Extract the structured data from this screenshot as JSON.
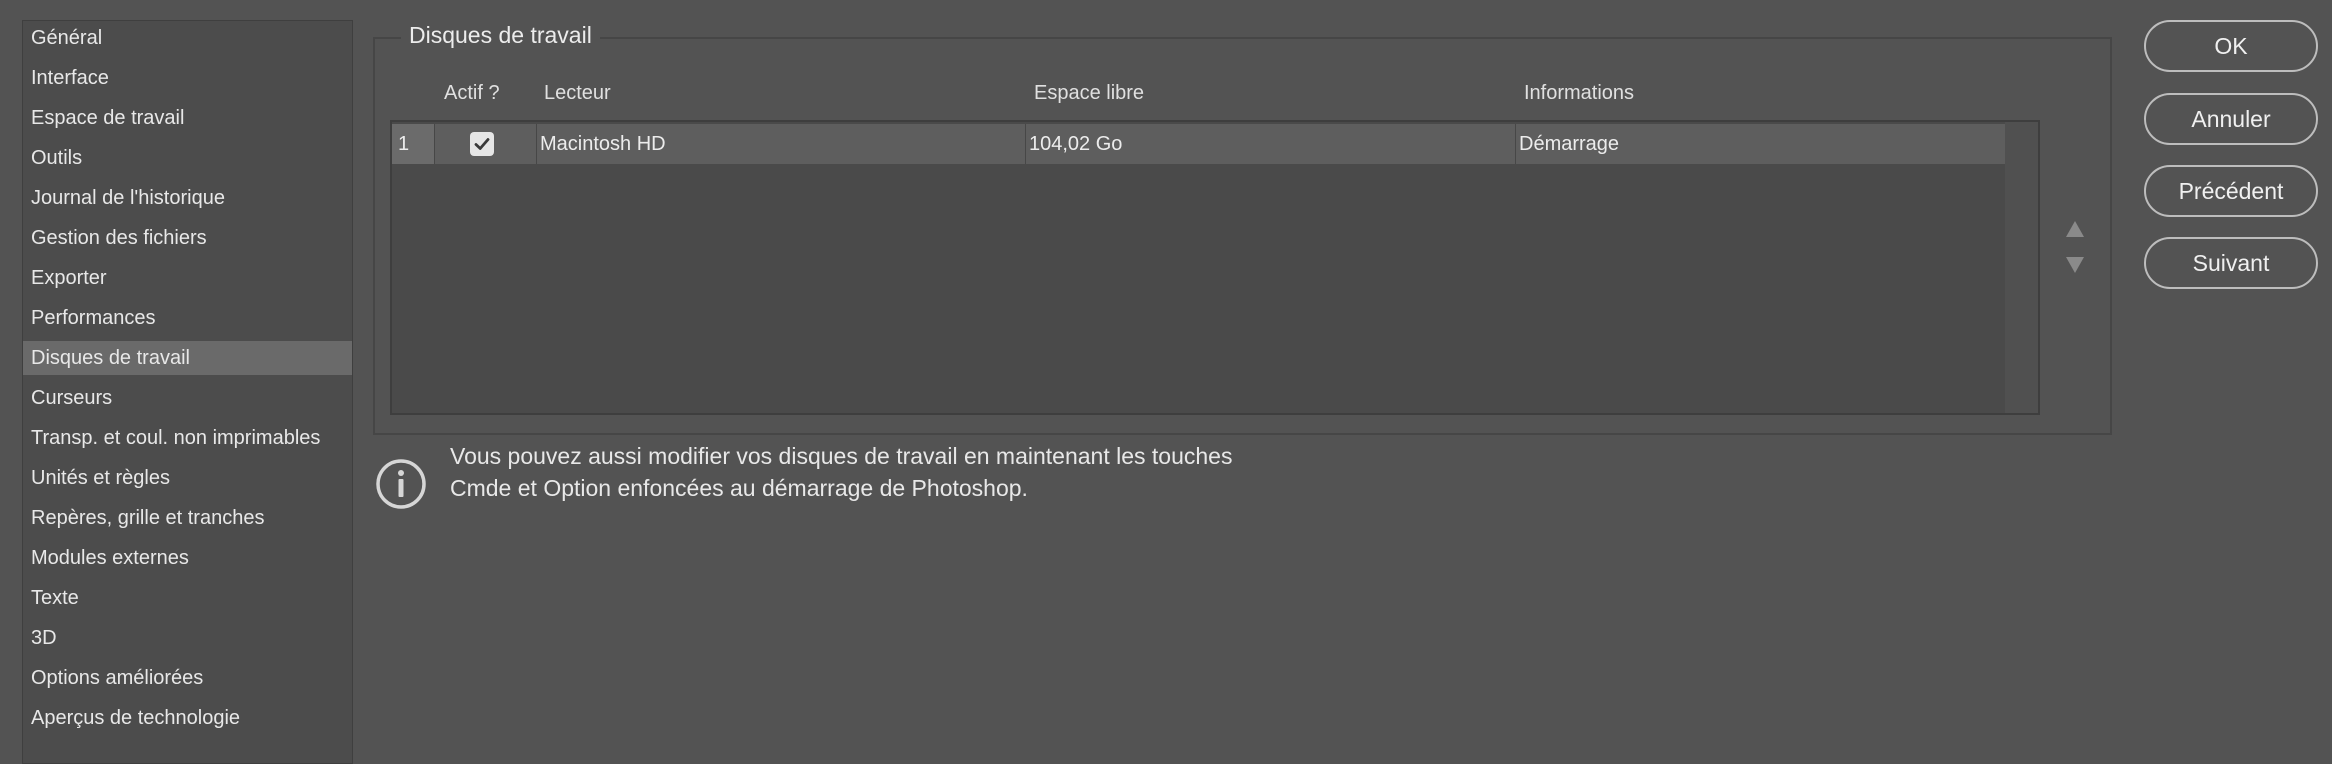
{
  "sidebar": {
    "items": [
      {
        "label": "Général"
      },
      {
        "label": "Interface"
      },
      {
        "label": "Espace de travail"
      },
      {
        "label": "Outils"
      },
      {
        "label": "Journal de l'historique"
      },
      {
        "label": "Gestion des fichiers"
      },
      {
        "label": "Exporter"
      },
      {
        "label": "Performances"
      },
      {
        "label": "Disques de travail",
        "selected": true
      },
      {
        "label": "Curseurs"
      },
      {
        "label": "Transp. et coul. non imprimables"
      },
      {
        "label": "Unités et règles"
      },
      {
        "label": "Repères, grille et tranches"
      },
      {
        "label": "Modules externes"
      },
      {
        "label": "Texte"
      },
      {
        "label": "3D"
      },
      {
        "label": "Options améliorées"
      },
      {
        "label": "Aperçus de technologie"
      }
    ]
  },
  "panel": {
    "title": "Disques de travail",
    "columns": [
      "Actif ?",
      "Lecteur",
      "Espace libre",
      "Informations"
    ],
    "rows": [
      {
        "index": "1",
        "active": true,
        "drive": "Macintosh HD",
        "free_space": "104,02 Go",
        "info": "Démarrage"
      }
    ],
    "move_up_icon": "triangle-up-icon",
    "move_down_icon": "triangle-down-icon"
  },
  "buttons": {
    "ok": "OK",
    "cancel": "Annuler",
    "previous": "Précédent",
    "next": "Suivant"
  },
  "info": {
    "icon": "info-icon",
    "line1": "Vous pouvez aussi modifier vos disques de travail en maintenant les touches",
    "line2": "Cmde et Option enfoncées au démarrage de Photoshop."
  },
  "colors": {
    "background": "#535353",
    "selected_item": "#6a6a6a"
  }
}
